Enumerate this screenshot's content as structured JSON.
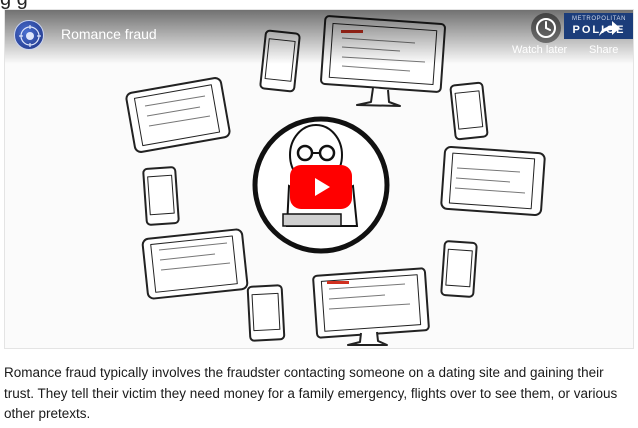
{
  "video": {
    "title": "Romance fraud",
    "watch_later_label": "Watch later",
    "share_label": "Share",
    "brand": {
      "top_line": "METROPOLITAN",
      "bottom_line": "POLICE"
    }
  },
  "caption": "Romance fraud typically involves the fraudster contacting someone on a dating site and gaining their trust. They tell their victim they need money for a family emergency, flights over to see them, or various other pretexts.",
  "colors": {
    "play_button": "#ff0000",
    "brand_background": "#1c3d7a",
    "channel_avatar": "#2a4aa8"
  },
  "icons": {
    "channel": "police-crest-icon",
    "clock": "clock-icon",
    "share": "share-arrow-icon",
    "play": "play-icon"
  }
}
